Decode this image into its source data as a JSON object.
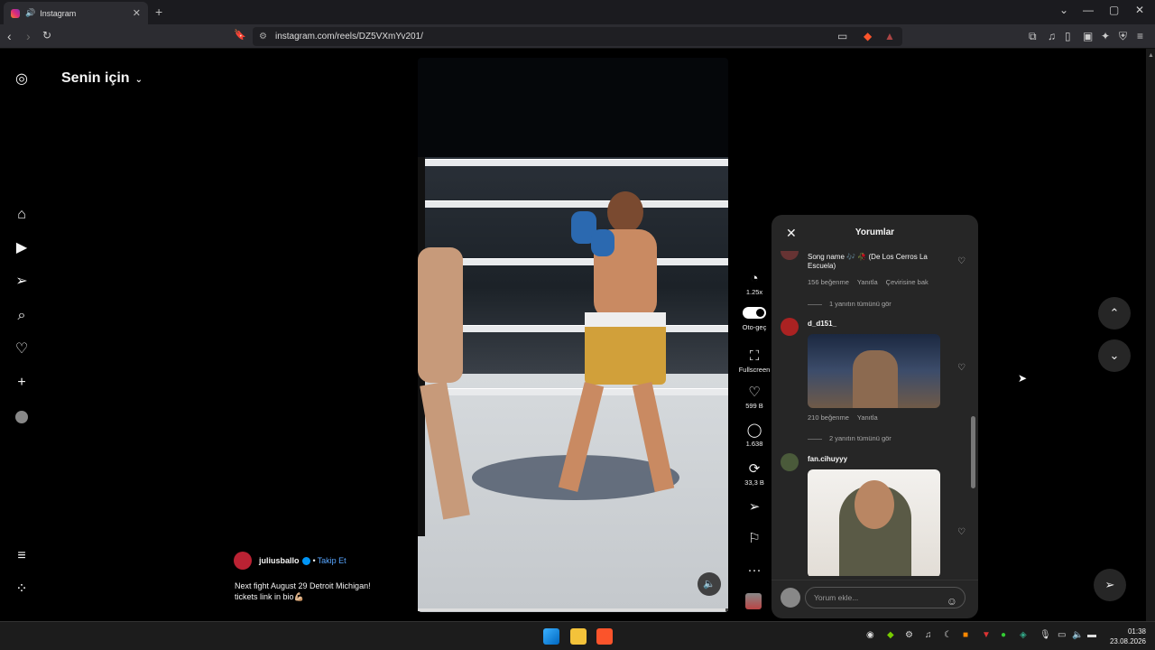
{
  "browser": {
    "tab_title": "Instagram",
    "url": "instagram.com/reels/DZ5VXmYv201/"
  },
  "feed": {
    "title": "Senin için"
  },
  "post": {
    "username": "juliusballo",
    "follow_label": "Takip Et",
    "separator": "•",
    "caption_line1": "Next fight August 29 Detroit Michigan!",
    "caption_line2": "tickets link in bio💪🏼",
    "progress": 0.99
  },
  "actions": {
    "speed": "1.25x",
    "autoplay": "Oto-geç",
    "fullscreen": "Fullscreen",
    "likes": "599 B",
    "comments": "1.638",
    "reposts": "33,3 B"
  },
  "comments_panel": {
    "title": "Yorumlar",
    "items": [
      {
        "text": "Song name 🎶 🥀 (De Los Cerros La Escuela)",
        "likes": "156 beğenme",
        "reply": "Yanıtla",
        "translate": "Çevirisine bak",
        "view_replies": "1 yanıtın tümünü gör"
      },
      {
        "username": "d_d151_",
        "likes": "210 beğenme",
        "reply": "Yanıtla",
        "view_replies": "2 yanıtın tümünü gör"
      },
      {
        "username": "fan.cihuyyy"
      }
    ],
    "input_placeholder": "Yorum ekle..."
  },
  "taskbar": {
    "time": "01:38",
    "date": "23.08.2026"
  },
  "icons": {
    "instagram": "instagram-logo-icon",
    "home": "home-icon",
    "reels": "reels-icon",
    "send": "send-icon",
    "search": "search-icon",
    "heart": "heart-icon",
    "create": "plus-icon",
    "menu": "menu-icon",
    "apps": "apps-icon"
  }
}
